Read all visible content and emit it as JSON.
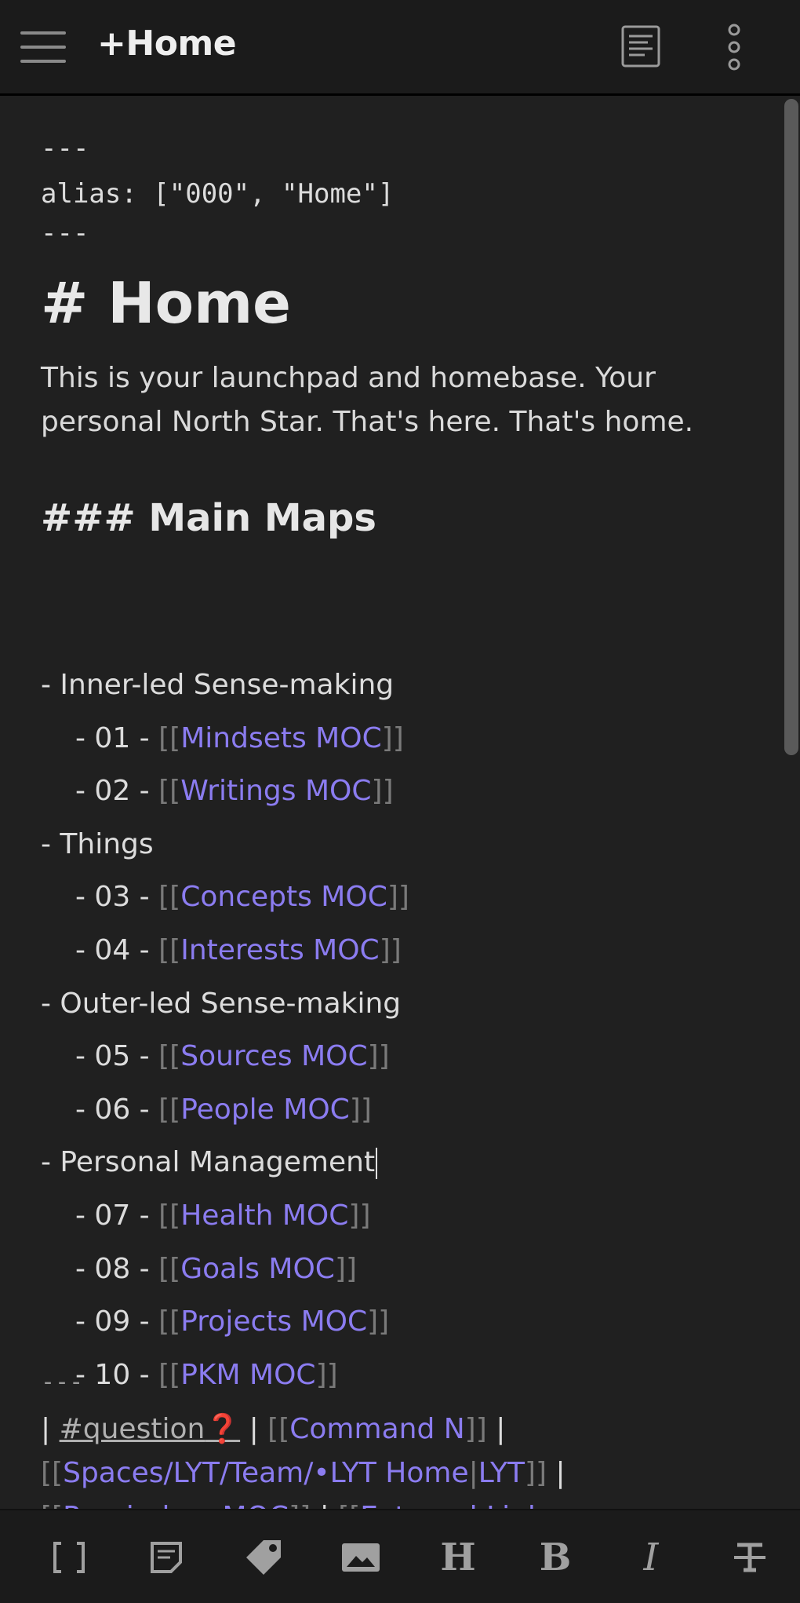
{
  "header": {
    "title": "+Home",
    "menu_icon": "hamburger-menu-icon",
    "reading_view_icon": "reading-view-icon",
    "more_icon": "more-options-icon"
  },
  "editor": {
    "frontmatter": [
      "---",
      "alias: [\"000\", \"Home\"]",
      "---"
    ],
    "h1": "# Home",
    "intro": "This is your launchpad and homebase. Your personal North Star. That's here. That's home.",
    "h3": "### Main Maps",
    "sections": [
      {
        "label": "- Inner-led Sense-making",
        "items": [
          {
            "prefix": "- 01 - ",
            "link": "Mindsets MOC"
          },
          {
            "prefix": "- 02 - ",
            "link": "Writings MOC"
          }
        ]
      },
      {
        "label": " - Things",
        "items": [
          {
            "prefix": "- 03 - ",
            "link": "Concepts MOC"
          },
          {
            "prefix": "- 04 - ",
            "link": "Interests MOC"
          }
        ]
      },
      {
        "label": "- Outer-led Sense-making",
        "items": [
          {
            "prefix": "- 05 - ",
            "link": "Sources MOC"
          },
          {
            "prefix": "- 06 - ",
            "link": "People MOC"
          }
        ]
      },
      {
        "label": "- Personal Management",
        "items": [
          {
            "prefix": "- 07 - ",
            "link": "Health MOC"
          },
          {
            "prefix": "- 08 - ",
            "link": "Goals MOC"
          },
          {
            "prefix": "- 09 - ",
            "link": "Projects MOC"
          },
          {
            "prefix": "- 10 - ",
            "link": "PKM MOC"
          }
        ]
      }
    ],
    "divider": "---",
    "footer": {
      "pipe": "|",
      "tag": "#question",
      "emoji": "❓",
      "links": [
        "Command N",
        "Spaces/LYT/Team/•LYT Home",
        "LYT",
        "Reminders MOC",
        "External Links"
      ],
      "open": "[[",
      "close": "]]"
    }
  },
  "toolbar": {
    "items": [
      "brackets-icon",
      "note-icon",
      "tag-icon",
      "image-icon",
      "heading-icon",
      "bold-icon",
      "italic-icon",
      "strikethrough-icon"
    ],
    "heading_label": "H",
    "bold_label": "B",
    "italic_label": "I"
  }
}
